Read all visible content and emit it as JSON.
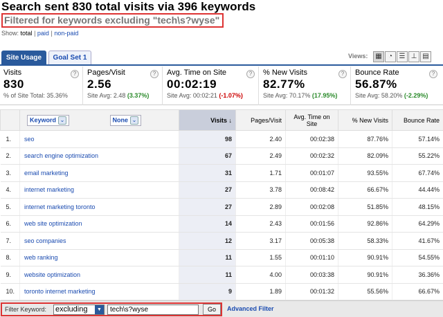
{
  "header": {
    "title": "Search sent 830 total visits via 396 keywords",
    "filter_note": "Filtered for keywords excluding \"tech\\s?wyse\""
  },
  "show": {
    "label": "Show:",
    "options": [
      "total",
      "paid",
      "non-paid"
    ],
    "selected": "total"
  },
  "tabs": [
    {
      "label": "Site Usage",
      "active": true
    },
    {
      "label": "Goal Set 1",
      "active": false
    }
  ],
  "views": {
    "label": "Views:",
    "icons": [
      "table-view-icon",
      "pie-view-icon",
      "performance-view-icon",
      "comparison-view-icon",
      "pivot-view-icon"
    ]
  },
  "summary": [
    {
      "label": "Visits",
      "value": "830",
      "sub_prefix": "% of Site Total: ",
      "sub_value": "35.36%",
      "delta": "",
      "delta_sign": ""
    },
    {
      "label": "Pages/Visit",
      "value": "2.56",
      "sub_prefix": "Site Avg: ",
      "sub_value": "2.48",
      "delta": "(3.37%)",
      "delta_sign": "pos"
    },
    {
      "label": "Avg. Time on Site",
      "value": "00:02:19",
      "sub_prefix": "Site Avg: ",
      "sub_value": "00:02:21",
      "delta": "(-1.07%)",
      "delta_sign": "neg"
    },
    {
      "label": "% New Visits",
      "value": "82.77%",
      "sub_prefix": "Site Avg: ",
      "sub_value": "70.17%",
      "delta": "(17.95%)",
      "delta_sign": "pos"
    },
    {
      "label": "Bounce Rate",
      "value": "56.87%",
      "sub_prefix": "Site Avg: ",
      "sub_value": "58.20%",
      "delta": "(-2.29%)",
      "delta_sign": "pos"
    }
  ],
  "table": {
    "dim1": "Keyword",
    "dim2": "None",
    "columns": [
      "Visits",
      "Pages/Visit",
      "Avg. Time on Site",
      "% New Visits",
      "Bounce Rate"
    ],
    "rows": [
      [
        "1.",
        "seo",
        "98",
        "2.40",
        "00:02:38",
        "87.76%",
        "57.14%"
      ],
      [
        "2.",
        "search engine optimization",
        "67",
        "2.49",
        "00:02:32",
        "82.09%",
        "55.22%"
      ],
      [
        "3.",
        "email marketing",
        "31",
        "1.71",
        "00:01:07",
        "93.55%",
        "67.74%"
      ],
      [
        "4.",
        "internet marketing",
        "27",
        "3.78",
        "00:08:42",
        "66.67%",
        "44.44%"
      ],
      [
        "5.",
        "internet marketing toronto",
        "27",
        "2.89",
        "00:02:08",
        "51.85%",
        "48.15%"
      ],
      [
        "6.",
        "web site optimization",
        "14",
        "2.43",
        "00:01:56",
        "92.86%",
        "64.29%"
      ],
      [
        "7.",
        "seo companies",
        "12",
        "3.17",
        "00:05:38",
        "58.33%",
        "41.67%"
      ],
      [
        "8.",
        "web ranking",
        "11",
        "1.55",
        "00:01:10",
        "90.91%",
        "54.55%"
      ],
      [
        "9.",
        "website optimization",
        "11",
        "4.00",
        "00:03:38",
        "90.91%",
        "36.36%"
      ],
      [
        "10.",
        "toronto internet marketing",
        "9",
        "1.89",
        "00:01:32",
        "55.56%",
        "66.67%"
      ]
    ]
  },
  "footer": {
    "filter_label": "Filter Keyword:",
    "mode": "excluding",
    "value": "tech\\s?wyse",
    "go": "Go",
    "advanced": "Advanced Filter"
  }
}
